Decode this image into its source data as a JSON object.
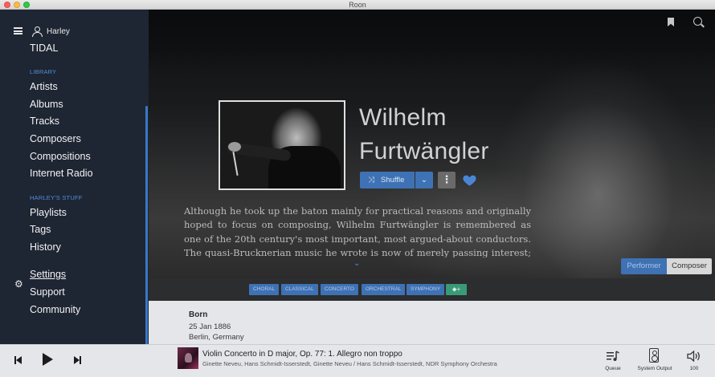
{
  "window": {
    "title": "Roon"
  },
  "sidebar": {
    "user": "Harley",
    "tidal": "TIDAL",
    "library_heading": "LIBRARY",
    "library_items": [
      "Artists",
      "Albums",
      "Tracks",
      "Composers",
      "Compositions",
      "Internet Radio"
    ],
    "stuff_heading": "HARLEY'S STUFF",
    "stuff_items": [
      "Playlists",
      "Tags",
      "History"
    ],
    "settings": "Settings",
    "support": "Support",
    "community": "Community"
  },
  "artist": {
    "name_line1": "Wilhelm",
    "name_line2": "Furtwängler",
    "shuffle_label": "Shuffle",
    "bio": "Although he took up the baton mainly for practical reasons and originally hoped to focus on composing, Wilhelm Furtwängler is remembered as one of the 20th century's most important, most argued-about conductors. The quasi-Brucknerian music he wrote is now of merely passing interest; Furtwängler was a truly",
    "role_performer": "Performer",
    "role_composer": "Composer",
    "tags": [
      "CHORAL",
      "CLASSICAL",
      "CONCERTO",
      "ORCHESTRAL",
      "SYMPHONY"
    ],
    "tag_add": "+",
    "born_label": "Born",
    "born_date": "25 Jan 1886",
    "born_place": "Berlin, Germany"
  },
  "player": {
    "track_title": "Violin Concerto in D major, Op. 77: 1. Allegro non troppo",
    "track_artists": "Ginette Neveu, Hans Schmidt-Isserstedt, Ginette Neveu / Hans Schmidt-Isserstedt, NDR Symphony Orchestra",
    "queue_label": "Queue",
    "output_label": "System Output",
    "volume": "100"
  },
  "colors": {
    "accent": "#3e72b4",
    "sidebar_bg": "#1e2533",
    "section_heading": "#4f8fdc",
    "heart": "#4a86d6",
    "tag_add": "#3a9a78"
  },
  "icons": [
    "hamburger-icon",
    "user-icon",
    "bookmark-icon",
    "search-icon",
    "shuffle-icon",
    "chevron-down-icon",
    "more-icon",
    "heart-icon",
    "gear-icon",
    "previous-icon",
    "play-icon",
    "next-icon",
    "queue-icon",
    "speaker-output-icon",
    "volume-icon"
  ]
}
